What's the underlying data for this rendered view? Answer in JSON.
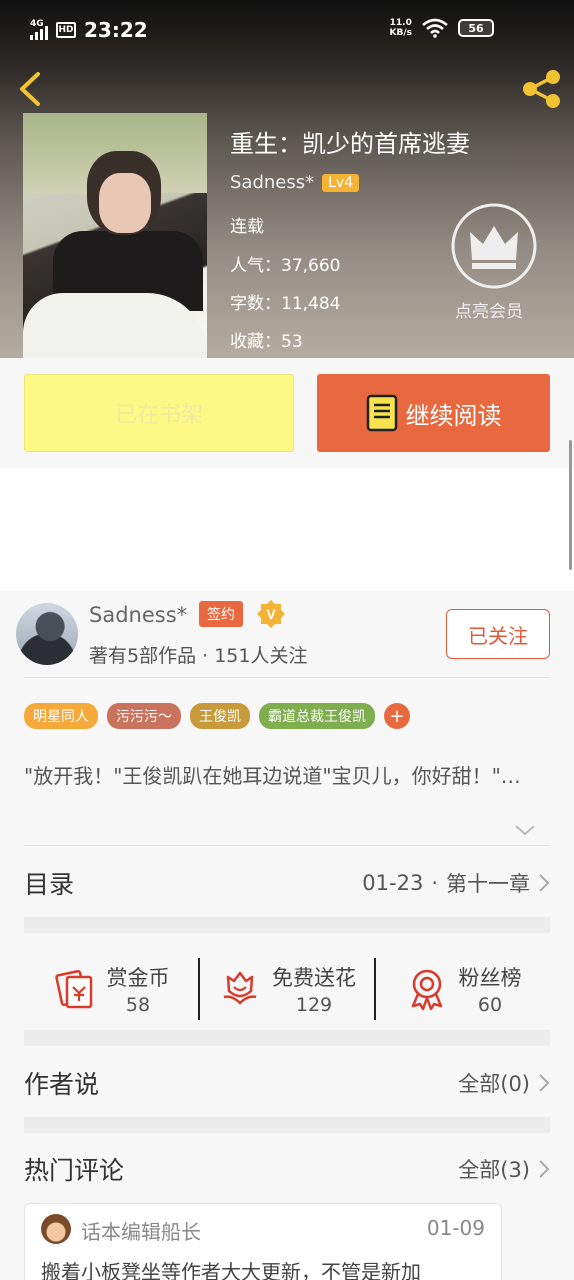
{
  "status_bar": {
    "network": "4G",
    "hd": "HD",
    "time": "23:22",
    "speed_value": "11.0",
    "speed_unit": "KB/s",
    "battery": "56"
  },
  "book": {
    "title": "重生：凯少的首席逃妻",
    "author": "Sadness*",
    "level": "Lv4",
    "status": "连载",
    "popularity": "人气：37,660",
    "word_count": "字数：11,484",
    "favorites": "收藏：53",
    "vip_label": "点亮会员"
  },
  "actions": {
    "shelf_label": "已在书架",
    "read_label": "继续阅读"
  },
  "author_card": {
    "name": "Sadness*",
    "sign_badge": "签约",
    "v_badge": "V",
    "summary": "著有5部作品 · 151人关注",
    "follow_label": "已关注"
  },
  "tags": [
    {
      "label": "明星同人",
      "color": "#f5a93b"
    },
    {
      "label": "污污污～",
      "color": "#c9735f"
    },
    {
      "label": "王俊凯",
      "color": "#c99a3c"
    },
    {
      "label": "霸道总裁王俊凯",
      "color": "#7fae4e"
    }
  ],
  "tag_add": "+",
  "description": "\"放开我！\"王俊凯趴在她耳边说道\"宝贝儿，你好甜！\"…",
  "catalog": {
    "label": "目录",
    "date": "01-23",
    "sep": "·",
    "chapter": "第十一章"
  },
  "stats": [
    {
      "label": "赏金币",
      "value": "58"
    },
    {
      "label": "免费送花",
      "value": "129"
    },
    {
      "label": "粉丝榜",
      "value": "60"
    }
  ],
  "author_says": {
    "label": "作者说",
    "all": "全部(0)"
  },
  "hot_comments": {
    "label": "热门评论",
    "all": "全部(3)"
  },
  "comment": {
    "user": "话本编辑船长",
    "date": "01-09",
    "text": "搬着小板凳坐等作者大大更新，不管是新加"
  },
  "colors": {
    "accent": "#e8693f",
    "shelf_bg": "#fef884",
    "level_badge": "#f5b335"
  }
}
